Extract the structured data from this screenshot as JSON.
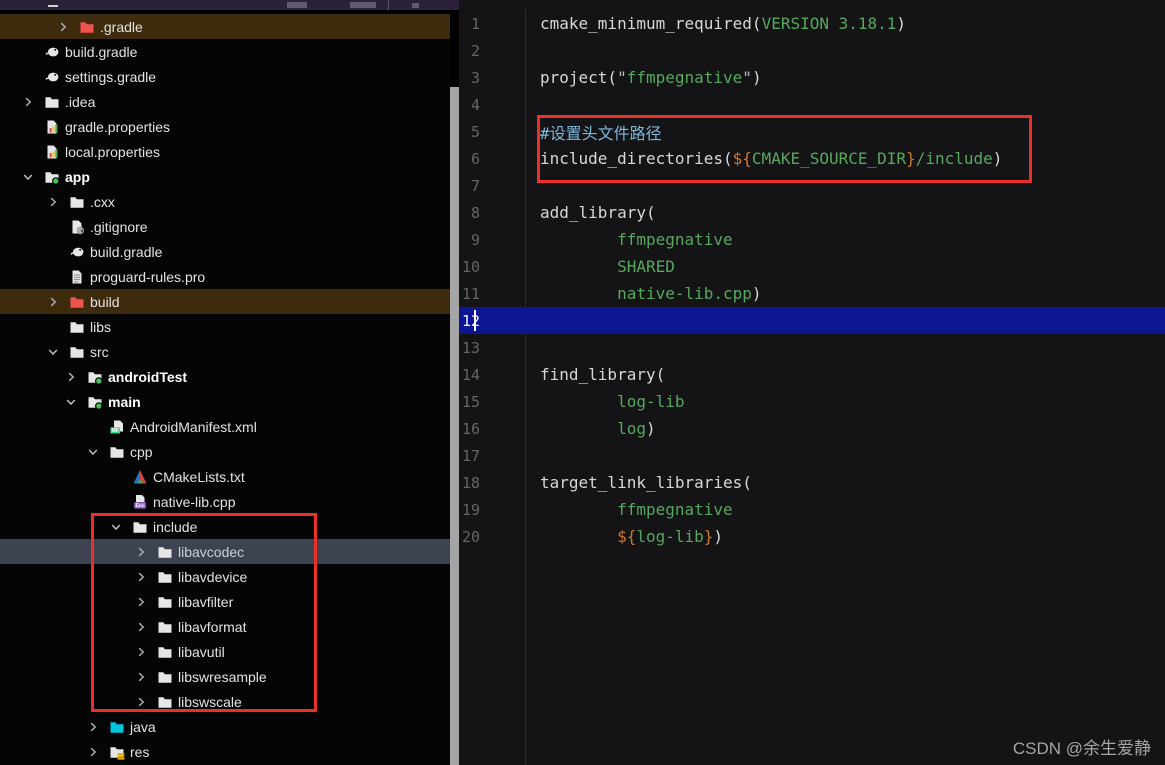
{
  "colors": {
    "accent_cyan": "#3ae0f0",
    "annotation_red": "#e8312b",
    "current_line_bg": "#0c1692",
    "code_plain": "#d8d8d8",
    "code_green": "#55a85c",
    "code_orange": "#cc7832",
    "code_comment": "#7db8dc",
    "tree_hover_bg": "#3e2a0d",
    "tree_selected_bg": "#3d4350",
    "folder_red": "#f0524f",
    "folder_cyan": "#00c4dc"
  },
  "watermark": "CSDN @余生爱静",
  "project_tree": {
    "items": [
      {
        "label": ".gradle",
        "indent": 55,
        "chevron": "right",
        "icon": "folder-red",
        "bold": false,
        "highlight": "brown"
      },
      {
        "label": "build.gradle",
        "indent": 20,
        "chevron": null,
        "icon": "gradle",
        "bold": false,
        "highlight": null
      },
      {
        "label": "settings.gradle",
        "indent": 20,
        "chevron": null,
        "icon": "gradle",
        "bold": false,
        "highlight": null
      },
      {
        "label": ".idea",
        "indent": 20,
        "chevron": "right",
        "icon": "folder",
        "bold": false,
        "highlight": null
      },
      {
        "label": "gradle.properties",
        "indent": 20,
        "chevron": null,
        "icon": "properties",
        "bold": false,
        "highlight": null
      },
      {
        "label": "local.properties",
        "indent": 20,
        "chevron": null,
        "icon": "properties",
        "bold": false,
        "highlight": null
      },
      {
        "label": "app",
        "indent": 20,
        "chevron": "down",
        "icon": "folder-dot",
        "bold": true,
        "highlight": null
      },
      {
        "label": ".cxx",
        "indent": 45,
        "chevron": "right",
        "icon": "folder",
        "bold": false,
        "highlight": null
      },
      {
        "label": ".gitignore",
        "indent": 45,
        "chevron": null,
        "icon": "gitignore",
        "bold": false,
        "highlight": null
      },
      {
        "label": "build.gradle",
        "indent": 45,
        "chevron": null,
        "icon": "gradle",
        "bold": false,
        "highlight": null
      },
      {
        "label": "proguard-rules.pro",
        "indent": 45,
        "chevron": null,
        "icon": "textfile",
        "bold": false,
        "highlight": null
      },
      {
        "label": "build",
        "indent": 45,
        "chevron": "right",
        "icon": "folder-red",
        "bold": false,
        "highlight": "brown"
      },
      {
        "label": "libs",
        "indent": 45,
        "chevron": null,
        "icon": "folder",
        "bold": false,
        "highlight": null
      },
      {
        "label": "src",
        "indent": 45,
        "chevron": "down",
        "icon": "folder",
        "bold": false,
        "highlight": null
      },
      {
        "label": "androidTest",
        "indent": 63,
        "chevron": "right",
        "icon": "folder-dot",
        "bold": true,
        "highlight": null
      },
      {
        "label": "main",
        "indent": 63,
        "chevron": "down",
        "icon": "folder-dot",
        "bold": true,
        "highlight": null
      },
      {
        "label": "AndroidManifest.xml",
        "indent": 85,
        "chevron": null,
        "icon": "manifest",
        "bold": false,
        "highlight": null
      },
      {
        "label": "cpp",
        "indent": 85,
        "chevron": "down",
        "icon": "folder",
        "bold": false,
        "highlight": null
      },
      {
        "label": "CMakeLists.txt",
        "indent": 108,
        "chevron": null,
        "icon": "cmake",
        "bold": false,
        "highlight": null
      },
      {
        "label": "native-lib.cpp",
        "indent": 108,
        "chevron": null,
        "icon": "cpp",
        "bold": false,
        "highlight": null
      },
      {
        "label": "include",
        "indent": 108,
        "chevron": "down",
        "icon": "folder",
        "bold": false,
        "highlight": null
      },
      {
        "label": "libavcodec",
        "indent": 133,
        "chevron": "right",
        "icon": "folder",
        "bold": false,
        "highlight": "selected"
      },
      {
        "label": "libavdevice",
        "indent": 133,
        "chevron": "right",
        "icon": "folder",
        "bold": false,
        "highlight": null
      },
      {
        "label": "libavfilter",
        "indent": 133,
        "chevron": "right",
        "icon": "folder",
        "bold": false,
        "highlight": null
      },
      {
        "label": "libavformat",
        "indent": 133,
        "chevron": "right",
        "icon": "folder",
        "bold": false,
        "highlight": null
      },
      {
        "label": "libavutil",
        "indent": 133,
        "chevron": "right",
        "icon": "folder",
        "bold": false,
        "highlight": null
      },
      {
        "label": "libswresample",
        "indent": 133,
        "chevron": "right",
        "icon": "folder",
        "bold": false,
        "highlight": null
      },
      {
        "label": "libswscale",
        "indent": 133,
        "chevron": "right",
        "icon": "folder",
        "bold": false,
        "highlight": null
      },
      {
        "label": "java",
        "indent": 85,
        "chevron": "right",
        "icon": "folder-cyan",
        "bold": false,
        "highlight": null
      },
      {
        "label": "res",
        "indent": 85,
        "chevron": "right",
        "icon": "folder-res",
        "bold": false,
        "highlight": null
      }
    ]
  },
  "editor": {
    "active_line": 12,
    "lines": [
      {
        "n": "1",
        "tokens": [
          {
            "t": "cmake_minimum_required(",
            "c": "p"
          },
          {
            "t": "VERSION 3.18.1",
            "c": "g"
          },
          {
            "t": ")",
            "c": "p"
          }
        ]
      },
      {
        "n": "2",
        "tokens": []
      },
      {
        "n": "3",
        "tokens": [
          {
            "t": "project(",
            "c": "p"
          },
          {
            "t": "\"",
            "c": "q"
          },
          {
            "t": "ffmpegnative",
            "c": "g"
          },
          {
            "t": "\"",
            "c": "q"
          },
          {
            "t": ")",
            "c": "p"
          }
        ]
      },
      {
        "n": "4",
        "tokens": []
      },
      {
        "n": "5",
        "tokens": [
          {
            "t": "#设置头文件路径",
            "c": "c"
          }
        ]
      },
      {
        "n": "6",
        "tokens": [
          {
            "t": "include_directories(",
            "c": "p"
          },
          {
            "t": "${",
            "c": "o"
          },
          {
            "t": "CMAKE_SOURCE_DIR",
            "c": "g"
          },
          {
            "t": "}",
            "c": "o"
          },
          {
            "t": "/include",
            "c": "g"
          },
          {
            "t": ")",
            "c": "p"
          }
        ]
      },
      {
        "n": "7",
        "tokens": []
      },
      {
        "n": "8",
        "tokens": [
          {
            "t": "add_library(",
            "c": "p"
          }
        ]
      },
      {
        "n": "9",
        "tokens": [
          {
            "t": "        ",
            "c": "p"
          },
          {
            "t": "ffmpegnative",
            "c": "g"
          }
        ]
      },
      {
        "n": "10",
        "tokens": [
          {
            "t": "        ",
            "c": "p"
          },
          {
            "t": "SHARED",
            "c": "g"
          }
        ]
      },
      {
        "n": "11",
        "tokens": [
          {
            "t": "        ",
            "c": "p"
          },
          {
            "t": "native-lib.cpp",
            "c": "g"
          },
          {
            "t": ")",
            "c": "p"
          }
        ]
      },
      {
        "n": "12",
        "tokens": [],
        "cursor": true
      },
      {
        "n": "13",
        "tokens": []
      },
      {
        "n": "14",
        "tokens": [
          {
            "t": "find_library(",
            "c": "p"
          }
        ]
      },
      {
        "n": "15",
        "tokens": [
          {
            "t": "        ",
            "c": "p"
          },
          {
            "t": "log-lib",
            "c": "g"
          }
        ]
      },
      {
        "n": "16",
        "tokens": [
          {
            "t": "        ",
            "c": "p"
          },
          {
            "t": "log",
            "c": "g"
          },
          {
            "t": ")",
            "c": "p"
          }
        ]
      },
      {
        "n": "17",
        "tokens": []
      },
      {
        "n": "18",
        "tokens": [
          {
            "t": "target_link_libraries(",
            "c": "p"
          }
        ]
      },
      {
        "n": "19",
        "tokens": [
          {
            "t": "        ",
            "c": "p"
          },
          {
            "t": "ffmpegnative",
            "c": "g"
          }
        ]
      },
      {
        "n": "20",
        "tokens": [
          {
            "t": "        ",
            "c": "p"
          },
          {
            "t": "${",
            "c": "o"
          },
          {
            "t": "log-lib",
            "c": "g"
          },
          {
            "t": "}",
            "c": "o"
          },
          {
            "t": ")",
            "c": "p"
          }
        ]
      }
    ]
  }
}
